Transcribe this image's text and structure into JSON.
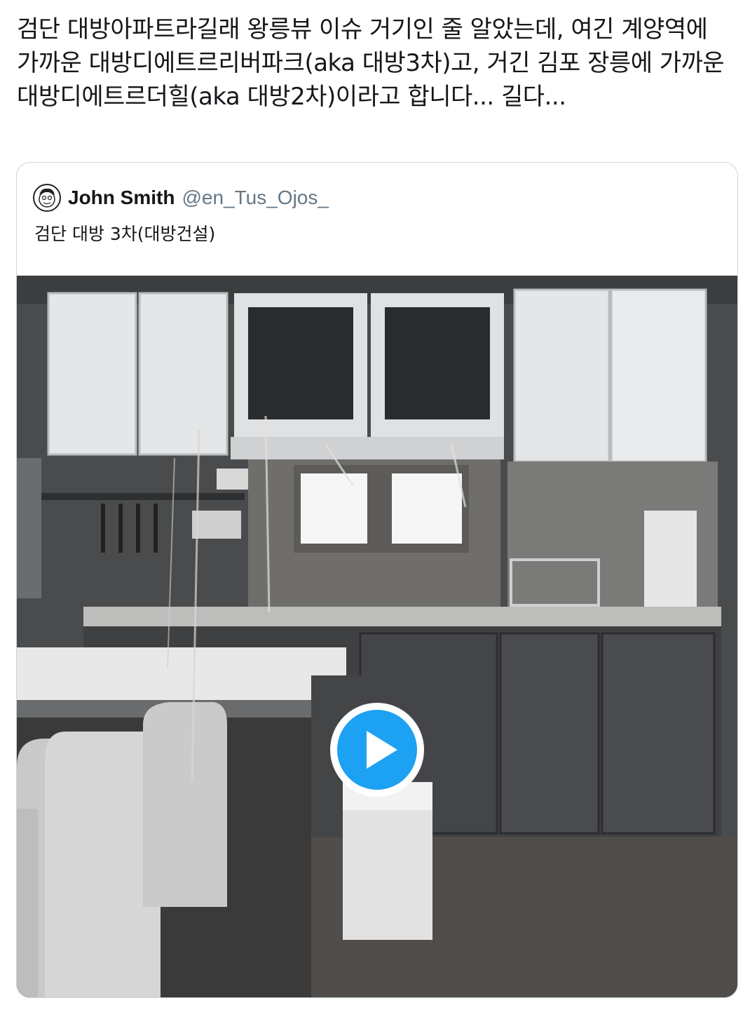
{
  "tweet": {
    "text": "검단 대방아파트라길래 왕릉뷰 이슈 거기인 줄 알았는데, 여긴 계양역에 가까운 대방디에트르리버파크(aka 대방3차)고, 거긴 김포 장릉에 가까운 대방디에트르더힐(aka 대방2차)이라고 합니다... 길다..."
  },
  "quoted_tweet": {
    "author_name": "John Smith",
    "author_handle": "@en_Tus_Ojos_",
    "text": "검단 대방 3차(대방건설)"
  },
  "media": {
    "type": "video",
    "play_icon": "play-icon",
    "accent_color": "#1da1f2"
  }
}
